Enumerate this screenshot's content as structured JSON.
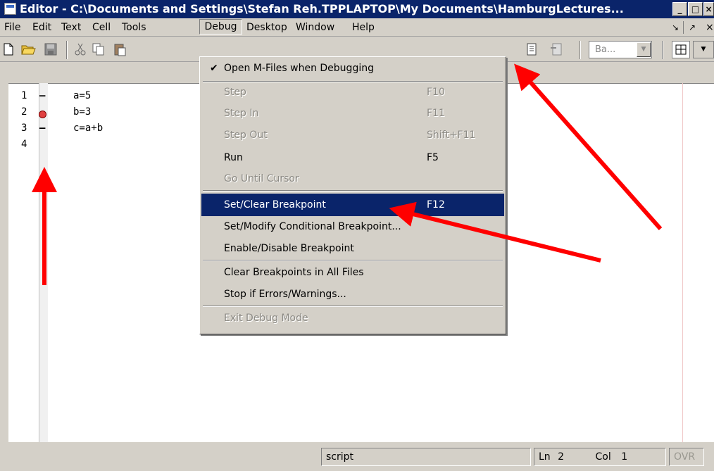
{
  "window": {
    "title": "Editor - C:\\Documents and Settings\\Stefan Reh.TPPLAPTOP\\My Documents\\HamburgLectures...",
    "minimize_label": "_",
    "maximize_label": "□",
    "close_label": "×"
  },
  "menubar": {
    "items": [
      "File",
      "Edit",
      "Text",
      "Cell",
      "Tools",
      "Debug",
      "Desktop",
      "Window",
      "Help"
    ],
    "undock_label": "↘",
    "dock_label": "↗",
    "close_label": "×"
  },
  "toolbar": {
    "stack_combo_value": "Ba...",
    "icons": [
      "new-file-icon",
      "open-file-icon",
      "save-icon",
      "cut-icon",
      "copy-icon",
      "paste-icon"
    ]
  },
  "editor": {
    "line_numbers": [
      "1",
      "2",
      "3",
      "4"
    ],
    "markers": [
      "–",
      "bp",
      "–",
      ""
    ],
    "lines": [
      "a=5",
      "b=3",
      "c=a+b",
      ""
    ]
  },
  "debug_menu": {
    "items": [
      {
        "label": "Open M-Files when Debugging",
        "shortcut": "",
        "checked": true,
        "enabled": true
      },
      {
        "label": "Step",
        "shortcut": "F10",
        "enabled": false
      },
      {
        "label": "Step In",
        "shortcut": "F11",
        "enabled": false
      },
      {
        "label": "Step Out",
        "shortcut": "Shift+F11",
        "enabled": false
      },
      {
        "label": "Run",
        "shortcut": "F5",
        "enabled": true
      },
      {
        "label": "Go Until Cursor",
        "shortcut": "",
        "enabled": false
      },
      {
        "label": "Set/Clear Breakpoint",
        "shortcut": "F12",
        "enabled": true,
        "selected": true
      },
      {
        "label": "Set/Modify Conditional Breakpoint...",
        "shortcut": "",
        "enabled": true
      },
      {
        "label": "Enable/Disable Breakpoint",
        "shortcut": "",
        "enabled": true
      },
      {
        "label": "Clear Breakpoints in All Files",
        "shortcut": "",
        "enabled": true
      },
      {
        "label": "Stop if Errors/Warnings...",
        "shortcut": "",
        "enabled": true
      },
      {
        "label": "Exit Debug Mode",
        "shortcut": "",
        "enabled": false
      }
    ]
  },
  "statusbar": {
    "mode": "script",
    "line_label": "Ln",
    "line_value": "2",
    "col_label": "Col",
    "col_value": "1",
    "ovr": "OVR"
  },
  "annotation_color": "#ff0000"
}
